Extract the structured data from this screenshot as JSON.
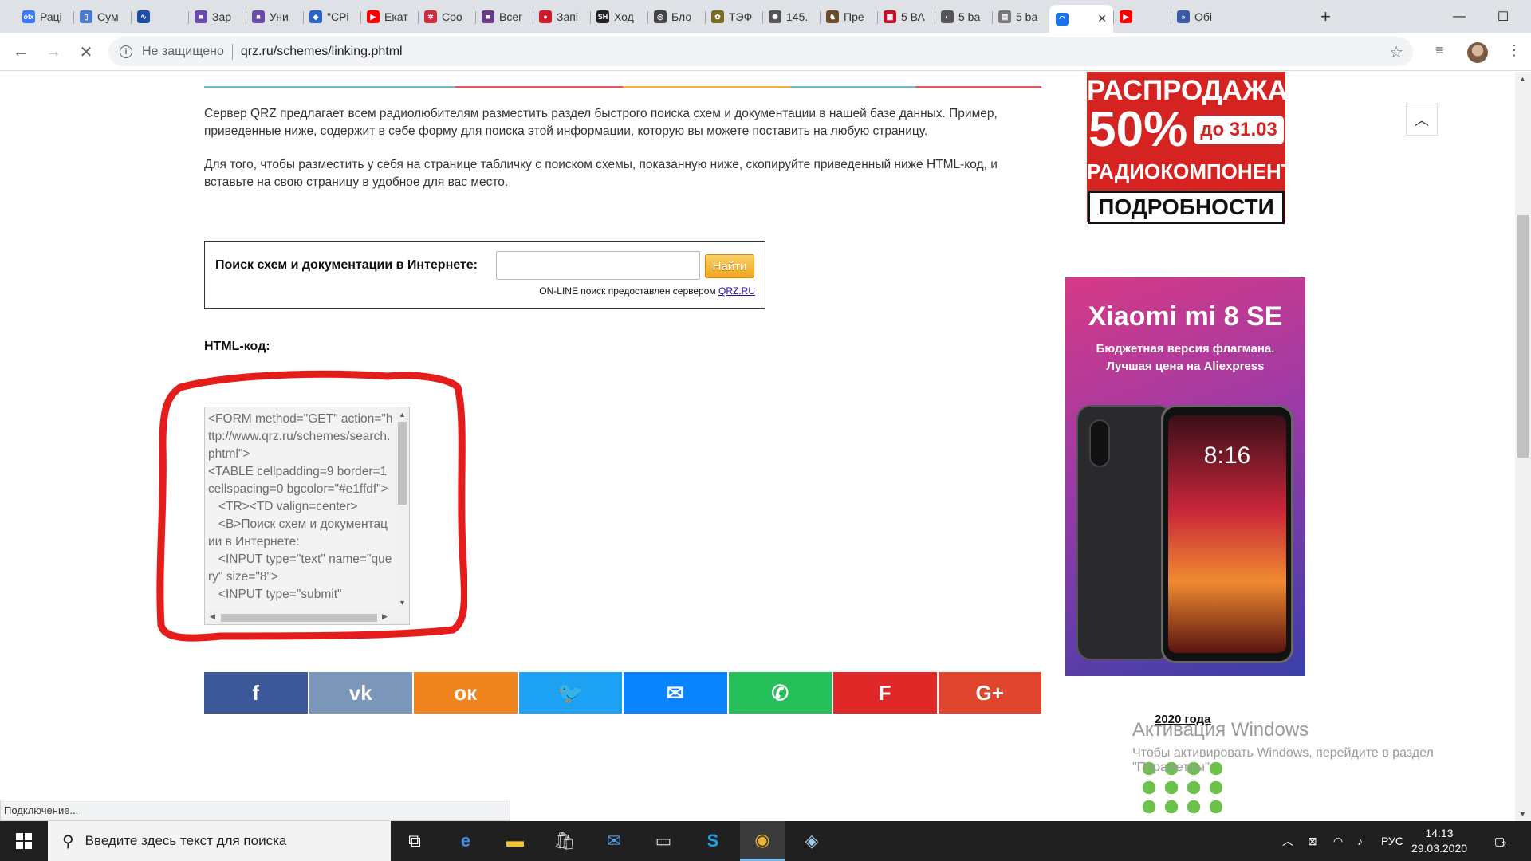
{
  "browser": {
    "tabs": [
      {
        "title": "Рацi",
        "icon": "olx-icon",
        "color": "#3a77ff",
        "glyph": "olx"
      },
      {
        "title": "Сум",
        "icon": "bag-icon",
        "color": "#4a7bd0",
        "glyph": "▯"
      },
      {
        "title": "",
        "icon": "pulse-icon",
        "color": "#1f4ea8",
        "glyph": "∿"
      },
      {
        "title": "Зар",
        "icon": "square-icon",
        "color": "#6a4aa8",
        "glyph": "■"
      },
      {
        "title": "Уни",
        "icon": "square-icon",
        "color": "#6a4aa8",
        "glyph": "■"
      },
      {
        "title": "\"СРі",
        "icon": "shield-icon",
        "color": "#2a64c8",
        "glyph": "◆"
      },
      {
        "title": "Екат",
        "icon": "youtube-icon",
        "color": "#ff0000",
        "glyph": "▶"
      },
      {
        "title": "Соо",
        "icon": "forum-icon",
        "color": "#d12a3a",
        "glyph": "✲"
      },
      {
        "title": "Всег",
        "icon": "square-icon",
        "color": "#6a3a88",
        "glyph": "■"
      },
      {
        "title": "Запі",
        "icon": "opera-icon",
        "color": "#d21a2a",
        "glyph": "●"
      },
      {
        "title": "Ход",
        "icon": "sh-icon",
        "color": "#222222",
        "glyph": "SH"
      },
      {
        "title": "Бло",
        "icon": "logo-icon",
        "color": "#444444",
        "glyph": "◎"
      },
      {
        "title": "ТЭФ",
        "icon": "logo-icon",
        "color": "#7a6a20",
        "glyph": "✿"
      },
      {
        "title": "145.",
        "icon": "logo-icon",
        "color": "#555555",
        "glyph": "✺"
      },
      {
        "title": "Пре",
        "icon": "person-icon",
        "color": "#6a4a2a",
        "glyph": "♞"
      },
      {
        "title": "5 ВА",
        "icon": "site-icon",
        "color": "#c4122a",
        "glyph": "▦"
      },
      {
        "title": "5 ba",
        "icon": "globe-icon",
        "color": "#555555",
        "glyph": "◐"
      },
      {
        "title": "5 ba",
        "icon": "page-icon",
        "color": "#777777",
        "glyph": "▤"
      },
      {
        "title": "",
        "icon": "loading-icon",
        "color": "#1a73e8",
        "glyph": "◠",
        "active": true
      },
      {
        "title": "",
        "icon": "youtube-icon",
        "color": "#ff0000",
        "glyph": "▶"
      },
      {
        "title": "Обі",
        "icon": "logo-icon",
        "color": "#3a5aa8",
        "glyph": "»"
      }
    ],
    "omnibox": {
      "security_text": "Не защищено",
      "url": "qrz.ru/schemes/linking.phtml"
    },
    "status_text": "Подключение..."
  },
  "page": {
    "paragraph1": "Сервер QRZ предлагает всем радиолюбителям разместить раздел быстрого поиска схем и документации в нашей базе данных. Пример, приведенные ниже, содержит в себе форму для поиска этой информации, которую вы можете поставить на любую страницу.",
    "paragraph2": "Для того, чтобы разместить у себя на странице табличку с поиском схемы, показанную ниже, скопируйте приведенный ниже HTML-код, и вставьте на свою страницу в удобное для вас место.",
    "search_widget": {
      "label": "Поиск схем и документации в Интернете:",
      "button": "Найти",
      "note": "ON-LINE поиск предоставлен сервером",
      "note_link": "QRZ.RU"
    },
    "html_label": "HTML-код:",
    "code": "<FORM method=\"GET\" action=\"http://www.qrz.ru/schemes/search.phtml\">\n<TABLE cellpadding=9 border=1 cellspacing=0 bgcolor=\"#e1ffdf\">\n   <TR><TD valign=center>\n   <B>Поиск схем и документации в Интернете:\n   <INPUT type=\"text\" name=\"query\" size=\"8\">\n   <INPUT type=\"submit\"",
    "social": [
      {
        "name": "facebook",
        "glyph": "f",
        "color": "#3b5998"
      },
      {
        "name": "vk",
        "glyph": "vk",
        "color": "#7b96b8"
      },
      {
        "name": "odnoklassniki",
        "glyph": "ок",
        "color": "#f0851f"
      },
      {
        "name": "twitter",
        "glyph": "🐦",
        "color": "#1da1f2"
      },
      {
        "name": "messenger",
        "glyph": "✉",
        "color": "#0a84ff"
      },
      {
        "name": "whatsapp",
        "glyph": "✆",
        "color": "#25c05a"
      },
      {
        "name": "flipboard",
        "glyph": "F",
        "color": "#e12828"
      },
      {
        "name": "google-plus",
        "glyph": "G+",
        "color": "#e0452e"
      }
    ],
    "ad_sale": {
      "line1": "РАСПРОДАЖА",
      "line2": "50%",
      "pill": "до 31.03",
      "line3": "РАДИОКОМПОНЕНТЫ",
      "line4": "ПОДРОБНОСТИ"
    },
    "ad_phone": {
      "title": "Xiaomi mi 8 SE",
      "subtitle1": "Бюджетная версия флагмана.",
      "subtitle2": "Лучшая цена на Aliexpress",
      "time": "8:16"
    },
    "year_label": "2020 года",
    "watermark_title": "Активация Windows",
    "watermark_text": "Чтобы активировать Windows, перейдите в раздел \"Параметры\"."
  },
  "taskbar": {
    "search_placeholder": "Введите здесь текст для поиска",
    "language": "РУС",
    "time": "14:13",
    "date": "29.03.2020",
    "notification_count": "2"
  }
}
